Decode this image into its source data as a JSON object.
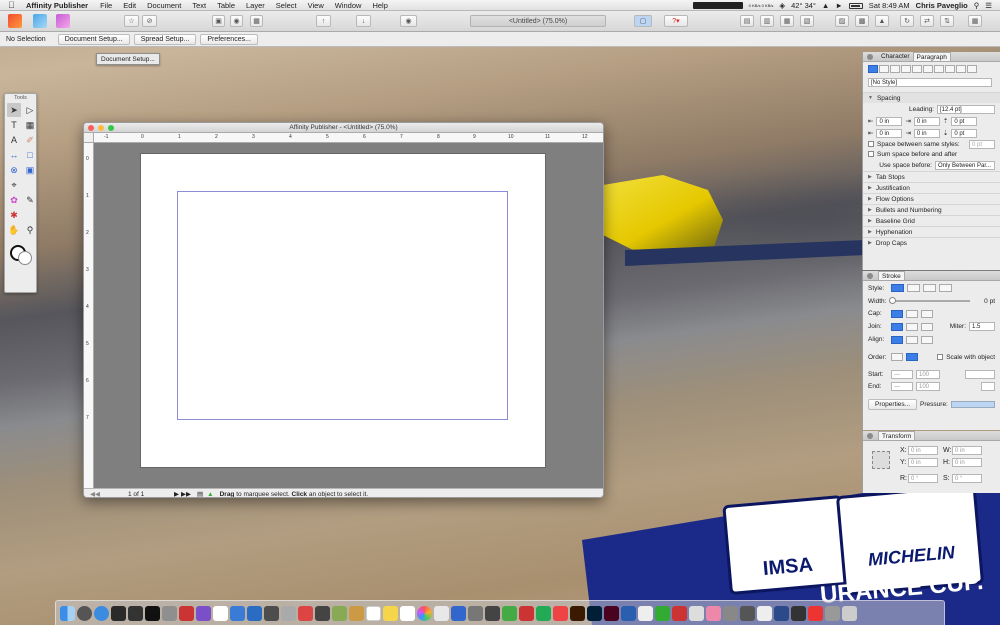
{
  "menubar": {
    "app_name": "Affinity Publisher",
    "menus": [
      "File",
      "Edit",
      "Document",
      "Text",
      "Table",
      "Layer",
      "Select",
      "View",
      "Window",
      "Help"
    ],
    "temp": "42° 34°",
    "net": "0 KB/s\n0 KB/s",
    "clock": "Sat 8:49 AM",
    "user": "Chris Paveglio"
  },
  "toolbar": {
    "document_title": "<Untitled> (75.0%)"
  },
  "context_toolbar": {
    "selection_label": "No Selection",
    "buttons": [
      "Document Setup...",
      "Spread Setup...",
      "Preferences..."
    ]
  },
  "tooltip": "Document Setup...",
  "tools_panel": {
    "title": "Tools"
  },
  "doc_window": {
    "title": "Affinity Publisher - <Untitled> (75.0%)",
    "ruler_labels": [
      "-1",
      "0",
      "1",
      "2",
      "3",
      "4",
      "5",
      "6",
      "7",
      "8",
      "9",
      "10",
      "11",
      "12"
    ],
    "vruler_labels": [
      "0",
      "1",
      "2",
      "3",
      "4",
      "5",
      "6",
      "7"
    ],
    "page_counter": "1 of 1",
    "status_drag": "Drag",
    "status_mid": "to marquee select.",
    "status_click": "Click",
    "status_end": "an object to select it."
  },
  "paragraph_panel": {
    "tabs": [
      "Character",
      "Paragraph"
    ],
    "style": "[No Style]",
    "spacing_header": "Spacing",
    "leading_label": "Leading:",
    "leading_value": "[12.4 pt]",
    "indent_left": "0 in",
    "indent_right": "0 in",
    "space_before": "0 pt",
    "first_indent": "0 in",
    "last_indent": "0 in",
    "space_after": "0 pt",
    "same_styles_label": "Space between same styles:",
    "same_styles_value": "0 pt",
    "sum_label": "Sum space before and after",
    "use_space_label": "Use space before:",
    "use_space_value": "Only Between Par...",
    "sections": [
      "Tab Stops",
      "Justification",
      "Flow Options",
      "Bullets and Numbering",
      "Baseline Grid",
      "Hyphenation",
      "Drop Caps"
    ]
  },
  "stroke_panel": {
    "title": "Stroke",
    "style_label": "Style:",
    "width_label": "Width:",
    "width_value": "0 pt",
    "cap_label": "Cap:",
    "join_label": "Join:",
    "miter_label": "Miter:",
    "miter_value": "1.5",
    "align_label": "Align:",
    "order_label": "Order:",
    "scale_label": "Scale with object",
    "start_label": "Start:",
    "start_value": "100",
    "end_label": "End:",
    "end_value": "100",
    "properties_btn": "Properties...",
    "pressure_label": "Pressure:"
  },
  "transform_panel": {
    "title": "Transform",
    "x_label": "X:",
    "x_value": "0 in",
    "y_label": "Y:",
    "y_value": "0 in",
    "w_label": "W:",
    "w_value": "0 in",
    "h_label": "H:",
    "h_value": "0 in",
    "r_label": "R:",
    "r_value": "0 °",
    "s_label": "S:",
    "s_value": "0 °"
  },
  "background": {
    "sign_left": "IMSA",
    "sign_right": "MICHELIN",
    "sign_bottom": "URANCE CUP."
  },
  "colors": {
    "accent": "#3c7ee8",
    "margin_guide": "#8c8cd6"
  }
}
